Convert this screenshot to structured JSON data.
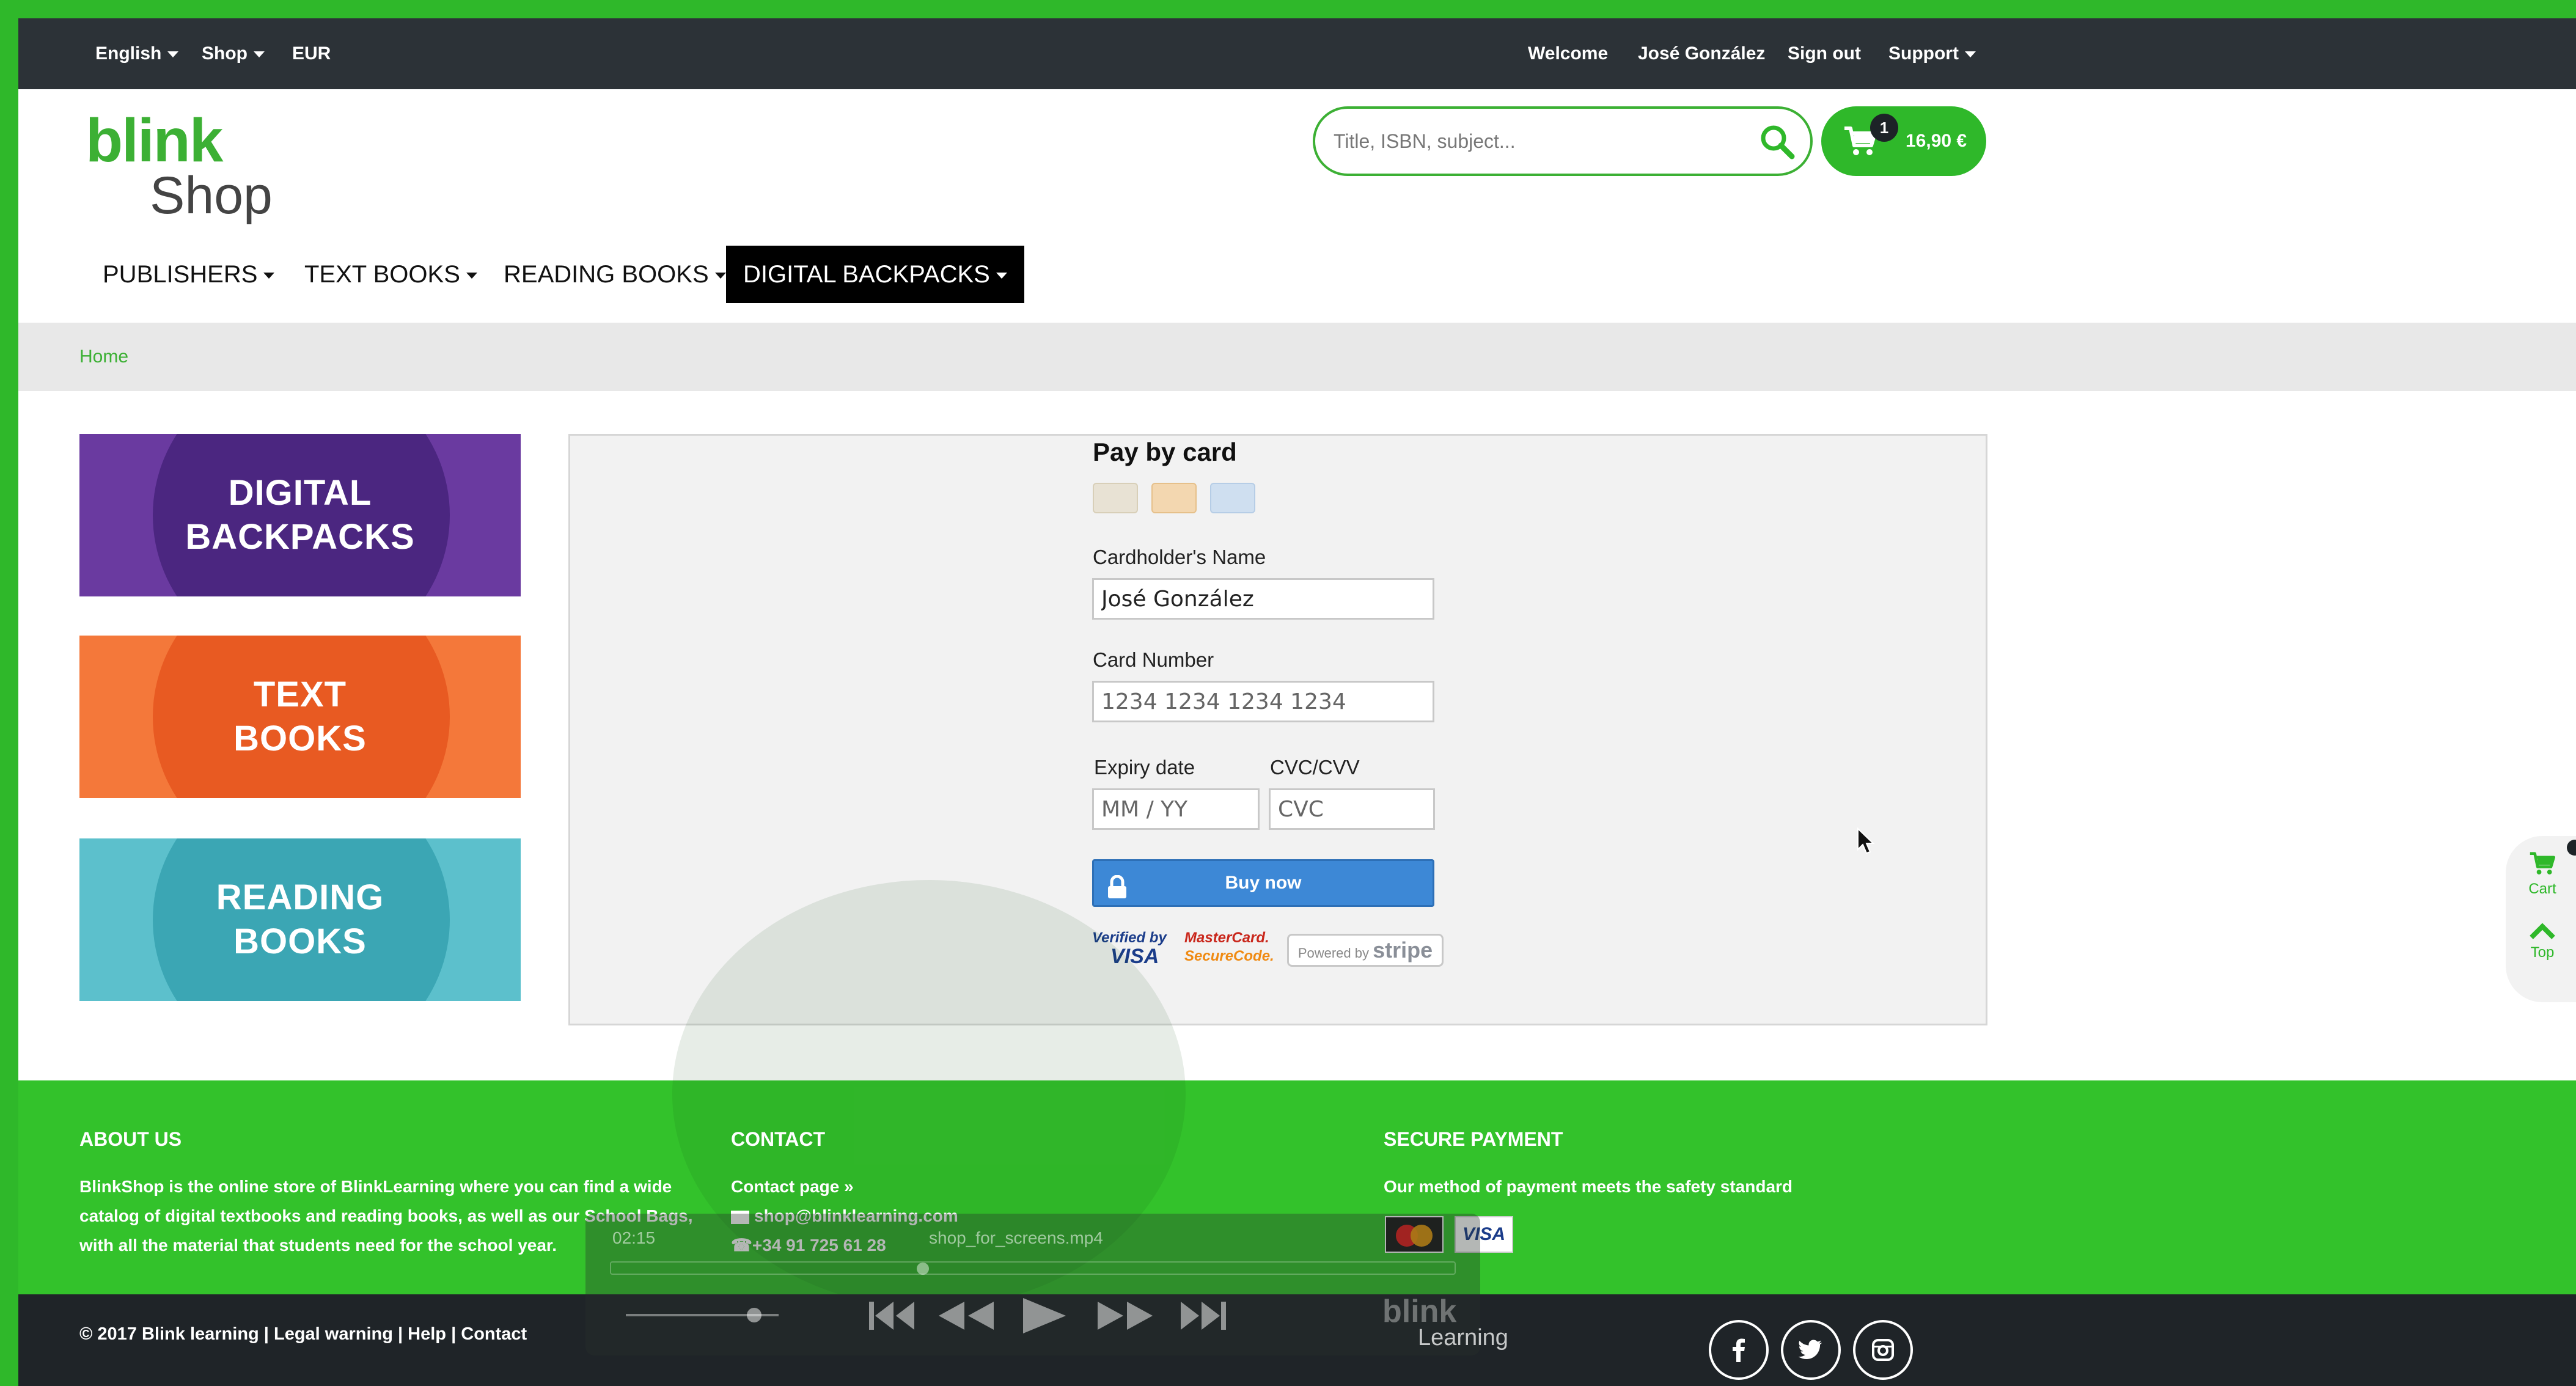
{
  "colors": {
    "brand_green": "#2fb82a",
    "topbar_bg": "#2c3237",
    "footer_green": "#33c22b",
    "footer_bottom_bg": "#1f2428",
    "buy_button_blue": "#3d88d6",
    "backpacks_purple": "#6a3aa0",
    "textbooks_orange": "#f4783a",
    "reading_teal": "#5cc0cc"
  },
  "topbar": {
    "language": "English",
    "shop": "Shop",
    "currency": "EUR",
    "welcome": "Welcome",
    "user_name": "José González",
    "sign_out": "Sign out",
    "support": "Support"
  },
  "header": {
    "logo_blink": "blink",
    "logo_shop": "Shop",
    "search_placeholder": "Title, ISBN, subject...",
    "search_icon": "search-icon",
    "cart_icon": "cart-icon",
    "cart_count": "1",
    "cart_total": "16,90 €"
  },
  "nav": {
    "items": [
      {
        "label": "PUBLISHERS"
      },
      {
        "label": "TEXT BOOKS"
      },
      {
        "label": "READING BOOKS"
      },
      {
        "label": "DIGITAL BACKPACKS",
        "active": true
      }
    ]
  },
  "breadcrumb": {
    "home": "Home"
  },
  "banners": {
    "backpacks": "DIGITAL\nBACKPACKS",
    "textbooks": "TEXT\nBOOKS",
    "reading": "READING\nBOOKS"
  },
  "payment": {
    "title": "Pay by card",
    "cardholder_label": "Cardholder's Name",
    "cardholder_value": "José González",
    "card_number_label": "Card Number",
    "card_number_placeholder": "1234 1234 1234 1234",
    "expiry_label": "Expiry date",
    "expiry_placeholder": "MM / YY",
    "cvc_label": "CVC/CVV",
    "cvc_placeholder": "CVC",
    "buy_label": "Buy now",
    "verified_by": "Verified by",
    "visa": "VISA",
    "mastercard": "MasterCard.",
    "securecode": "SecureCode.",
    "powered_by": "Powered by",
    "stripe": "stripe"
  },
  "side_widget": {
    "cart": "Cart",
    "top": "Top"
  },
  "footer": {
    "about_title": "ABOUT US",
    "about_text_1": "BlinkShop is the online store of BlinkLearning where you can find a wide",
    "about_text_2": "catalog of digital textbooks and reading books, as well as our School Bags,",
    "about_text_3": "with all the material that students need for the school year.",
    "contact_title": "CONTACT",
    "contact_page": "Contact page »",
    "contact_email": "shop@blinklearning.com",
    "contact_phone": "+34 91 725 61 28",
    "secure_title": "SECURE PAYMENT",
    "secure_text": "Our method of payment meets the safety standard",
    "copyright": "© 2017 Blink learning | Legal warning | Help | Contact"
  },
  "video_overlay": {
    "time": "02:15",
    "filename": "shop_for_screens.mp4",
    "progress_fraction": 0.37,
    "logo": "blink",
    "logo_sub": "Learning"
  }
}
